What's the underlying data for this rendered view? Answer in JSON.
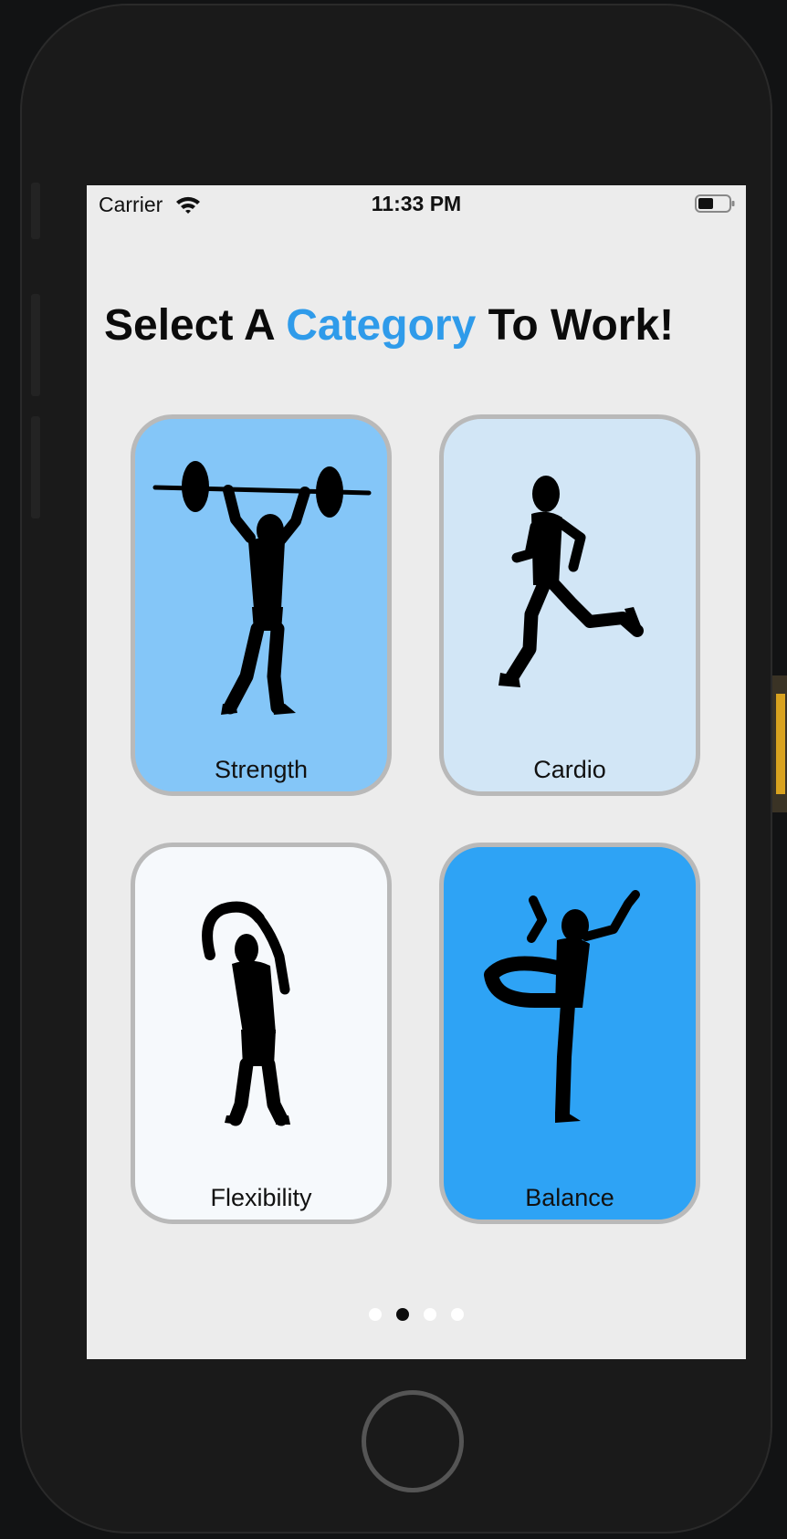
{
  "status_bar": {
    "carrier": "Carrier",
    "time": "11:33 PM"
  },
  "title": {
    "part1": "Select A ",
    "highlight": "Category",
    "part2": " To Work!"
  },
  "categories": [
    {
      "label": "Strength",
      "icon": "weightlifter-icon",
      "color": "#84c6f8"
    },
    {
      "label": "Cardio",
      "icon": "runner-icon",
      "color": "#d2e6f6"
    },
    {
      "label": "Flexibility",
      "icon": "side-stretch-icon",
      "color": "#f6f9fc"
    },
    {
      "label": "Balance",
      "icon": "yoga-balance-icon",
      "color": "#2ea3f5"
    }
  ],
  "pager": {
    "total": 4,
    "current": 2
  },
  "accent_color": "#2f9bea"
}
